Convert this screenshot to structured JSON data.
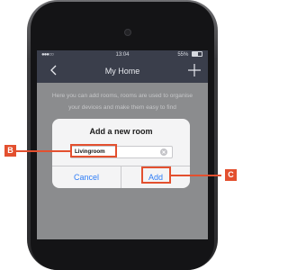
{
  "status_bar": {
    "signal": "●●●○○",
    "time": "13:04",
    "battery_percent": "55%"
  },
  "nav": {
    "title": "My Home"
  },
  "description": "Here you can add rooms, rooms are used to organise your devices and make them easy to find",
  "dialog": {
    "title": "Add a new room",
    "input_value": "Livingroom",
    "cancel_label": "Cancel",
    "add_label": "Add"
  },
  "callouts": {
    "input": "B",
    "add": "C"
  },
  "colors": {
    "navbar": "#3a3e4b",
    "dialog_button": "#2f7df6",
    "callout": "#e3502f"
  }
}
